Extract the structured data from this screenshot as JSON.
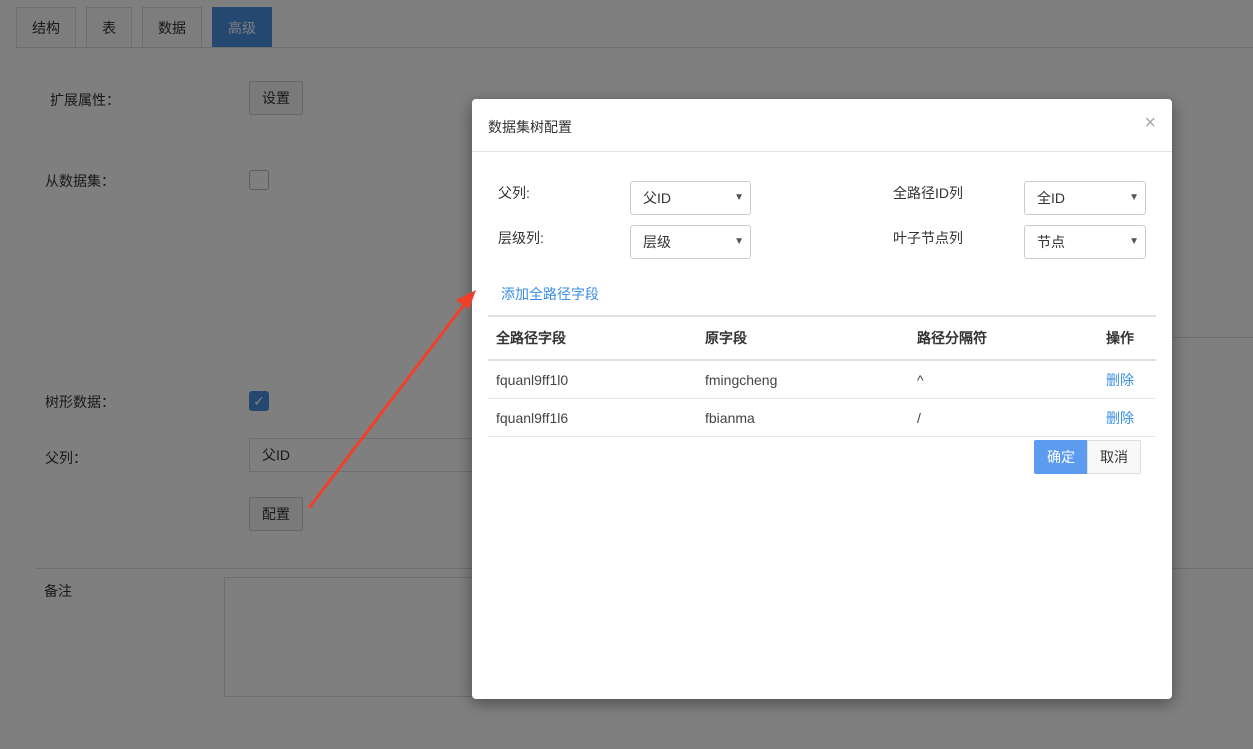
{
  "tabs": [
    {
      "label": "结构"
    },
    {
      "label": "表"
    },
    {
      "label": "数据"
    },
    {
      "label": "高级"
    }
  ],
  "form": {
    "ext_props_label": "扩展属性：",
    "settings_button": "设置",
    "from_dataset_label": "从数据集：",
    "tree_data_label": "树形数据：",
    "tree_data_checked": true,
    "parent_col_label": "父列：",
    "parent_col_value": "父ID",
    "config_button": "配置",
    "remark_label": "备注"
  },
  "modal": {
    "title": "数据集树配置",
    "close_symbol": "×",
    "parent_col_label": "父列:",
    "parent_col_value": "父ID",
    "level_col_label": "层级列:",
    "level_col_value": "层级",
    "fullpath_id_label": "全路径ID列",
    "fullpath_id_value": "全ID",
    "leaf_col_label": "叶子节点列",
    "leaf_col_value": "节点",
    "add_field_link": "添加全路径字段",
    "table": {
      "headers": [
        "全路径字段",
        "原字段",
        "路径分隔符",
        "操作"
      ],
      "rows": [
        {
          "path_field": "fquanl9ff1l0",
          "orig_field": "fmingcheng",
          "separator": "^",
          "action": "删除"
        },
        {
          "path_field": "fquanl9ff1l6",
          "orig_field": "fbianma",
          "separator": "/",
          "action": "删除"
        }
      ]
    },
    "ok_button": "确定",
    "cancel_button": "取消"
  },
  "colors": {
    "accent": "#4a90e2",
    "link": "#3a8ee6",
    "arrow": "#f0402a",
    "overlay": "rgba(0,0,0,0.5)"
  }
}
